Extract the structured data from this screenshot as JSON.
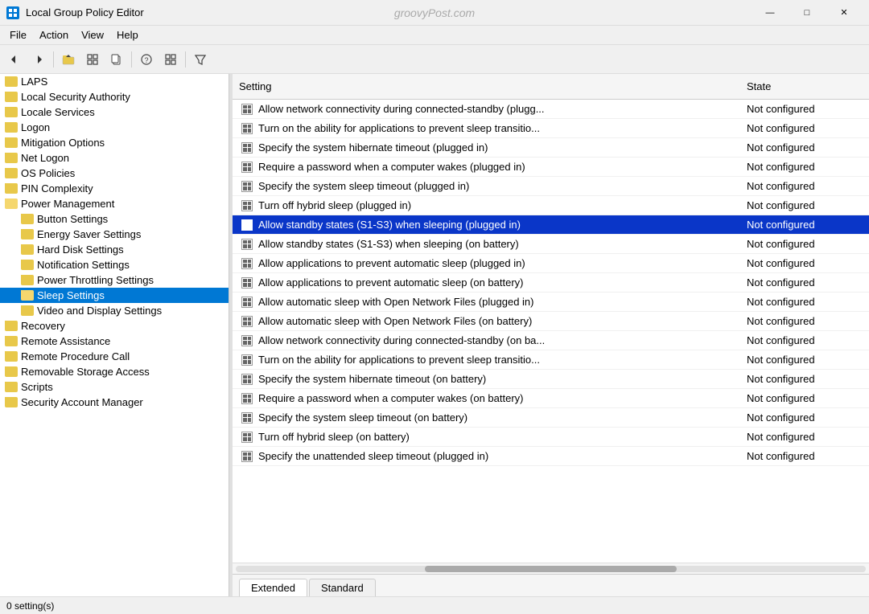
{
  "titleBar": {
    "appName": "Local Group Policy Editor",
    "watermark": "groovyPost.com",
    "minimizeBtn": "—",
    "maximizeBtn": "□",
    "closeBtn": "✕"
  },
  "menuBar": {
    "items": [
      "File",
      "Action",
      "View",
      "Help"
    ]
  },
  "toolbar": {
    "buttons": [
      "◀",
      "▶",
      "📁",
      "▦",
      "📋",
      "?",
      "▦",
      "⊞",
      "▼"
    ]
  },
  "leftPanel": {
    "items": [
      {
        "label": "LAPS",
        "indent": 0,
        "type": "folder",
        "selected": false
      },
      {
        "label": "Local Security Authority",
        "indent": 0,
        "type": "folder",
        "selected": false
      },
      {
        "label": "Locale Services",
        "indent": 0,
        "type": "folder",
        "selected": false
      },
      {
        "label": "Logon",
        "indent": 0,
        "type": "folder",
        "selected": false
      },
      {
        "label": "Mitigation Options",
        "indent": 0,
        "type": "folder",
        "selected": false
      },
      {
        "label": "Net Logon",
        "indent": 0,
        "type": "folder",
        "selected": false
      },
      {
        "label": "OS Policies",
        "indent": 0,
        "type": "folder",
        "selected": false
      },
      {
        "label": "PIN Complexity",
        "indent": 0,
        "type": "folder",
        "selected": false
      },
      {
        "label": "Power Management",
        "indent": 0,
        "type": "folder-open",
        "selected": false
      },
      {
        "label": "Button Settings",
        "indent": 1,
        "type": "folder",
        "selected": false
      },
      {
        "label": "Energy Saver Settings",
        "indent": 1,
        "type": "folder",
        "selected": false
      },
      {
        "label": "Hard Disk Settings",
        "indent": 1,
        "type": "folder",
        "selected": false
      },
      {
        "label": "Notification Settings",
        "indent": 1,
        "type": "folder",
        "selected": false
      },
      {
        "label": "Power Throttling Settings",
        "indent": 1,
        "type": "folder",
        "selected": false
      },
      {
        "label": "Sleep Settings",
        "indent": 1,
        "type": "folder",
        "selected": true
      },
      {
        "label": "Video and Display Settings",
        "indent": 1,
        "type": "folder",
        "selected": false
      },
      {
        "label": "Recovery",
        "indent": 0,
        "type": "folder",
        "selected": false
      },
      {
        "label": "Remote Assistance",
        "indent": 0,
        "type": "folder",
        "selected": false
      },
      {
        "label": "Remote Procedure Call",
        "indent": 0,
        "type": "folder",
        "selected": false
      },
      {
        "label": "Removable Storage Access",
        "indent": 0,
        "type": "folder",
        "selected": false
      },
      {
        "label": "Scripts",
        "indent": 0,
        "type": "folder",
        "selected": false
      },
      {
        "label": "Security Account Manager",
        "indent": 0,
        "type": "folder",
        "selected": false
      }
    ]
  },
  "tableHeader": {
    "colSetting": "Setting",
    "colState": "State"
  },
  "tableRows": [
    {
      "setting": "Allow network connectivity during connected-standby (plugg...",
      "state": "Not configured",
      "highlighted": false
    },
    {
      "setting": "Turn on the ability for applications to prevent sleep transitio...",
      "state": "Not configured",
      "highlighted": false
    },
    {
      "setting": "Specify the system hibernate timeout (plugged in)",
      "state": "Not configured",
      "highlighted": false
    },
    {
      "setting": "Require a password when a computer wakes (plugged in)",
      "state": "Not configured",
      "highlighted": false
    },
    {
      "setting": "Specify the system sleep timeout (plugged in)",
      "state": "Not configured",
      "highlighted": false
    },
    {
      "setting": "Turn off hybrid sleep (plugged in)",
      "state": "Not configured",
      "highlighted": false
    },
    {
      "setting": "Allow standby states (S1-S3) when sleeping (plugged in)",
      "state": "Not configured",
      "highlighted": true
    },
    {
      "setting": "Allow standby states (S1-S3) when sleeping (on battery)",
      "state": "Not configured",
      "highlighted": false
    },
    {
      "setting": "Allow applications to prevent automatic sleep (plugged in)",
      "state": "Not configured",
      "highlighted": false
    },
    {
      "setting": "Allow applications to prevent automatic sleep (on battery)",
      "state": "Not configured",
      "highlighted": false
    },
    {
      "setting": "Allow automatic sleep with Open Network Files (plugged in)",
      "state": "Not configured",
      "highlighted": false
    },
    {
      "setting": "Allow automatic sleep with Open Network Files (on battery)",
      "state": "Not configured",
      "highlighted": false
    },
    {
      "setting": "Allow network connectivity during connected-standby (on ba...",
      "state": "Not configured",
      "highlighted": false
    },
    {
      "setting": "Turn on the ability for applications to prevent sleep transitio...",
      "state": "Not configured",
      "highlighted": false
    },
    {
      "setting": "Specify the system hibernate timeout (on battery)",
      "state": "Not configured",
      "highlighted": false
    },
    {
      "setting": "Require a password when a computer wakes (on battery)",
      "state": "Not configured",
      "highlighted": false
    },
    {
      "setting": "Specify the system sleep timeout (on battery)",
      "state": "Not configured",
      "highlighted": false
    },
    {
      "setting": "Turn off hybrid sleep (on battery)",
      "state": "Not configured",
      "highlighted": false
    },
    {
      "setting": "Specify the unattended sleep timeout (plugged in)",
      "state": "Not configured",
      "highlighted": false
    }
  ],
  "tabs": [
    {
      "label": "Extended",
      "active": true
    },
    {
      "label": "Standard",
      "active": false
    }
  ],
  "statusBar": {
    "text": "0 setting(s)"
  }
}
